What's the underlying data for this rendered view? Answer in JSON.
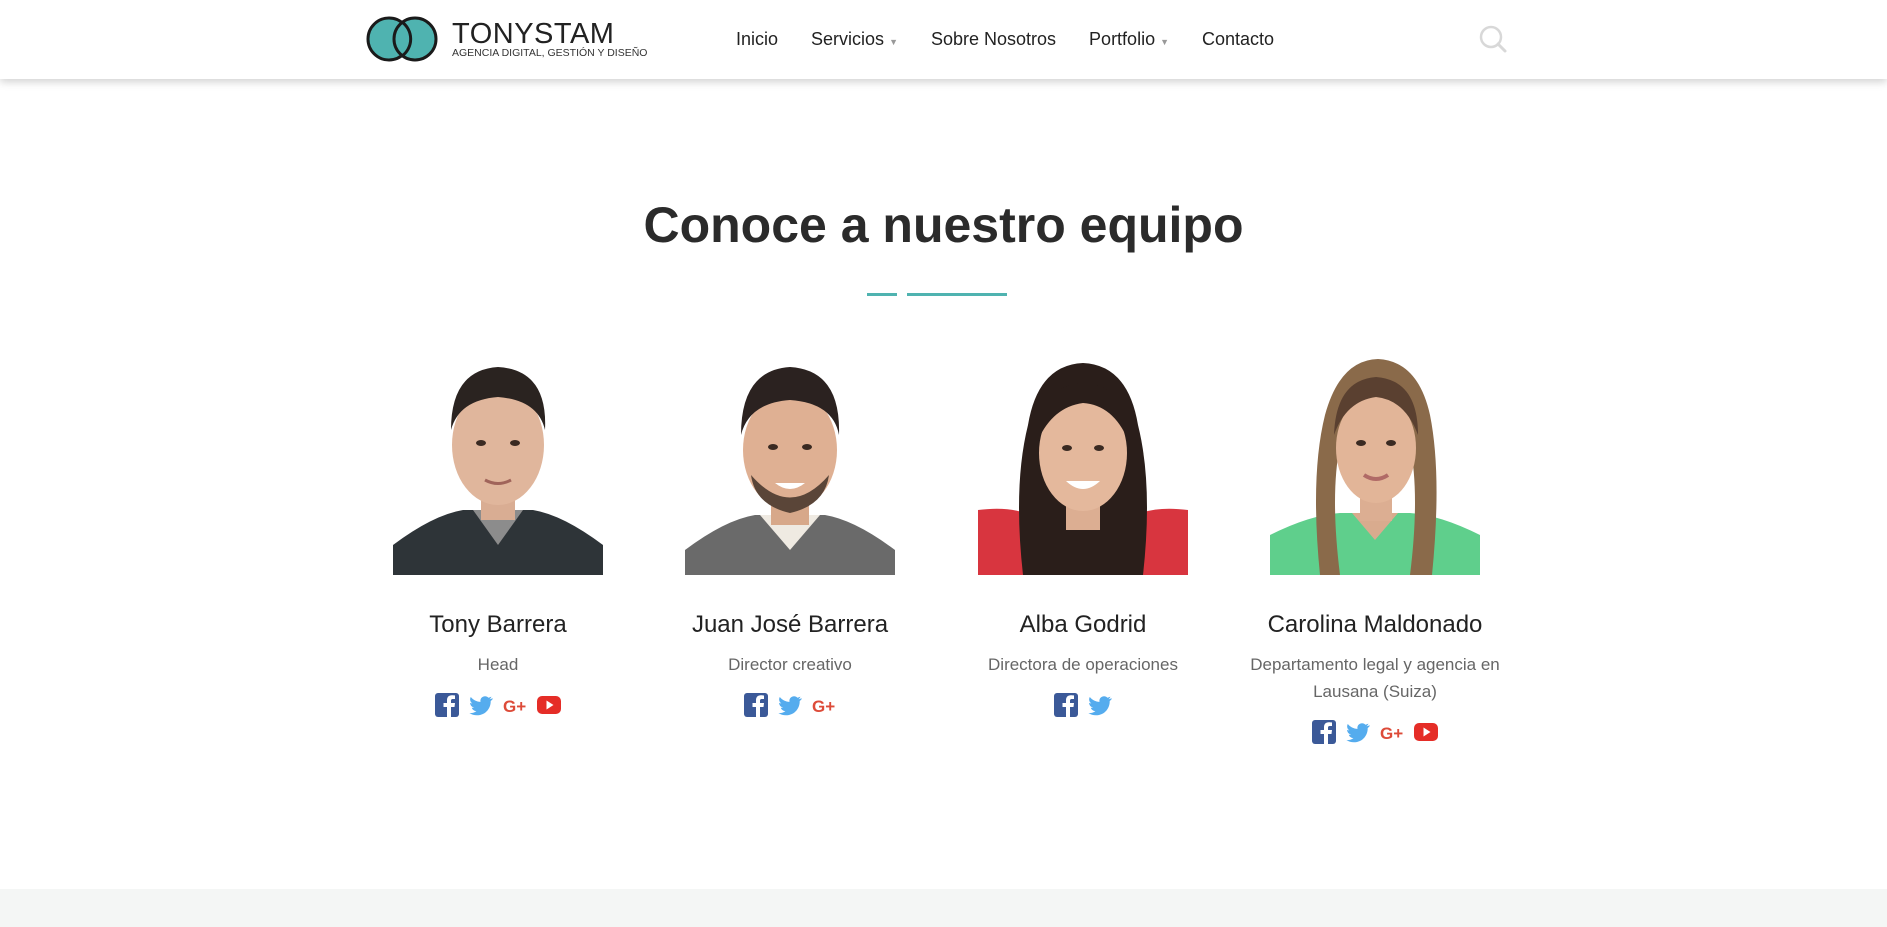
{
  "brand": {
    "name": "TONYSTAM",
    "tagline": "AGENCIA DIGITAL, GESTIÓN Y DISEÑO",
    "logo_color": "#4fb3b0"
  },
  "nav": {
    "items": [
      {
        "label": "Inicio",
        "has_dropdown": false
      },
      {
        "label": "Servicios",
        "has_dropdown": true
      },
      {
        "label": "Sobre Nosotros",
        "has_dropdown": false
      },
      {
        "label": "Portfolio",
        "has_dropdown": true
      },
      {
        "label": "Contacto",
        "has_dropdown": false
      }
    ],
    "search_icon": "search-icon"
  },
  "team": {
    "title": "Conoce a nuestro equipo",
    "accent_color": "#4fb3b0",
    "members": [
      {
        "name": "Tony Barrera",
        "role": "Head",
        "socials": [
          "facebook",
          "twitter",
          "google-plus",
          "youtube"
        ]
      },
      {
        "name": "Juan José Barrera",
        "role": "Director creativo",
        "socials": [
          "facebook",
          "twitter",
          "google-plus"
        ]
      },
      {
        "name": "Alba Godrid",
        "role": "Directora de operaciones",
        "socials": [
          "facebook",
          "twitter"
        ]
      },
      {
        "name": "Carolina Maldonado",
        "role": "Departamento legal y agencia en Lausana (Suiza)",
        "socials": [
          "facebook",
          "twitter",
          "google-plus",
          "youtube"
        ]
      }
    ]
  },
  "social_colors": {
    "facebook": "#3b5998",
    "twitter": "#55acee",
    "google-plus": "#dd4b39",
    "youtube": "#e52d27"
  }
}
